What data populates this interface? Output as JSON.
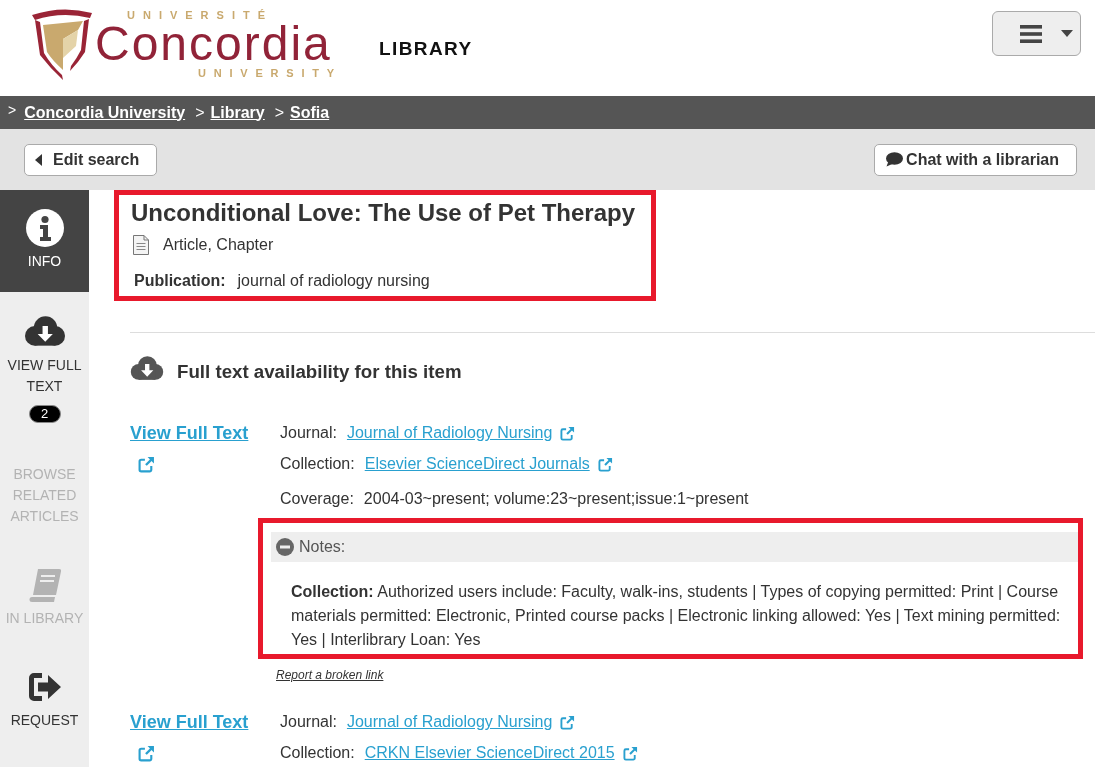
{
  "header": {
    "logo": {
      "upper_text": "UNIVERSITÉ",
      "name": "Concordia",
      "lower_text": "UNIVERSITY"
    },
    "section_title": "LIBRARY"
  },
  "breadcrumbs": [
    {
      "separator": ">",
      "label": "Concordia University"
    },
    {
      "separator": ">",
      "label": "Library"
    },
    {
      "separator": ">",
      "label": "Sofia"
    }
  ],
  "toolbar": {
    "back_button": "Edit search",
    "chat_button": "Chat with a librarian"
  },
  "sidebar": {
    "items": [
      {
        "kind": "info",
        "label": "INFO",
        "selected": true,
        "disabled": false
      },
      {
        "kind": "download",
        "label": "VIEW FULL TEXT",
        "badge": "2",
        "selected": false,
        "disabled": false
      },
      {
        "kind": "related",
        "label": "BROWSE RELATED ARTICLES",
        "selected": false,
        "disabled": true
      },
      {
        "kind": "book",
        "label": "IN LIBRARY",
        "selected": false,
        "disabled": true
      },
      {
        "kind": "request",
        "label": "REQUEST",
        "selected": false,
        "disabled": false
      }
    ]
  },
  "record": {
    "highlighted": true,
    "title": "Unconditional Love: The Use of Pet Therapy",
    "format": "Article, Chapter",
    "publication_label": "Publication:",
    "publication": "journal of radiology nursing"
  },
  "availability": {
    "heading": "Full text availability for this item",
    "entries": [
      {
        "link": "View Full Text",
        "fields": [
          {
            "kind": "link",
            "label": "Journal:",
            "value": "Journal of Radiology Nursing"
          },
          {
            "kind": "link",
            "label": "Collection:",
            "value": "Elsevier ScienceDirect Journals"
          },
          {
            "kind": "text",
            "label": "Coverage:",
            "value": "2004-03~present; volume:23~present;issue:1~present"
          }
        ],
        "notes": {
          "highlighted": true,
          "expanded": true,
          "title": "Notes:",
          "text": "**Collection:** Authorized users include: Faculty, walk-ins, students | Types of copying permitted: Print | Course materials permitted: Electronic, Printed course packs | Electronic linking allowed: Yes | Text mining permitted: Yes | Interlibrary Loan: Yes"
        },
        "report_link": "Report a broken link"
      },
      {
        "link": "View Full Text",
        "fields": [
          {
            "kind": "link",
            "label": "Journal:",
            "value": "Journal of Radiology Nursing"
          },
          {
            "kind": "link",
            "label": "Collection:",
            "value": "CRKN Elsevier ScienceDirect 2015"
          }
        ]
      }
    ]
  }
}
